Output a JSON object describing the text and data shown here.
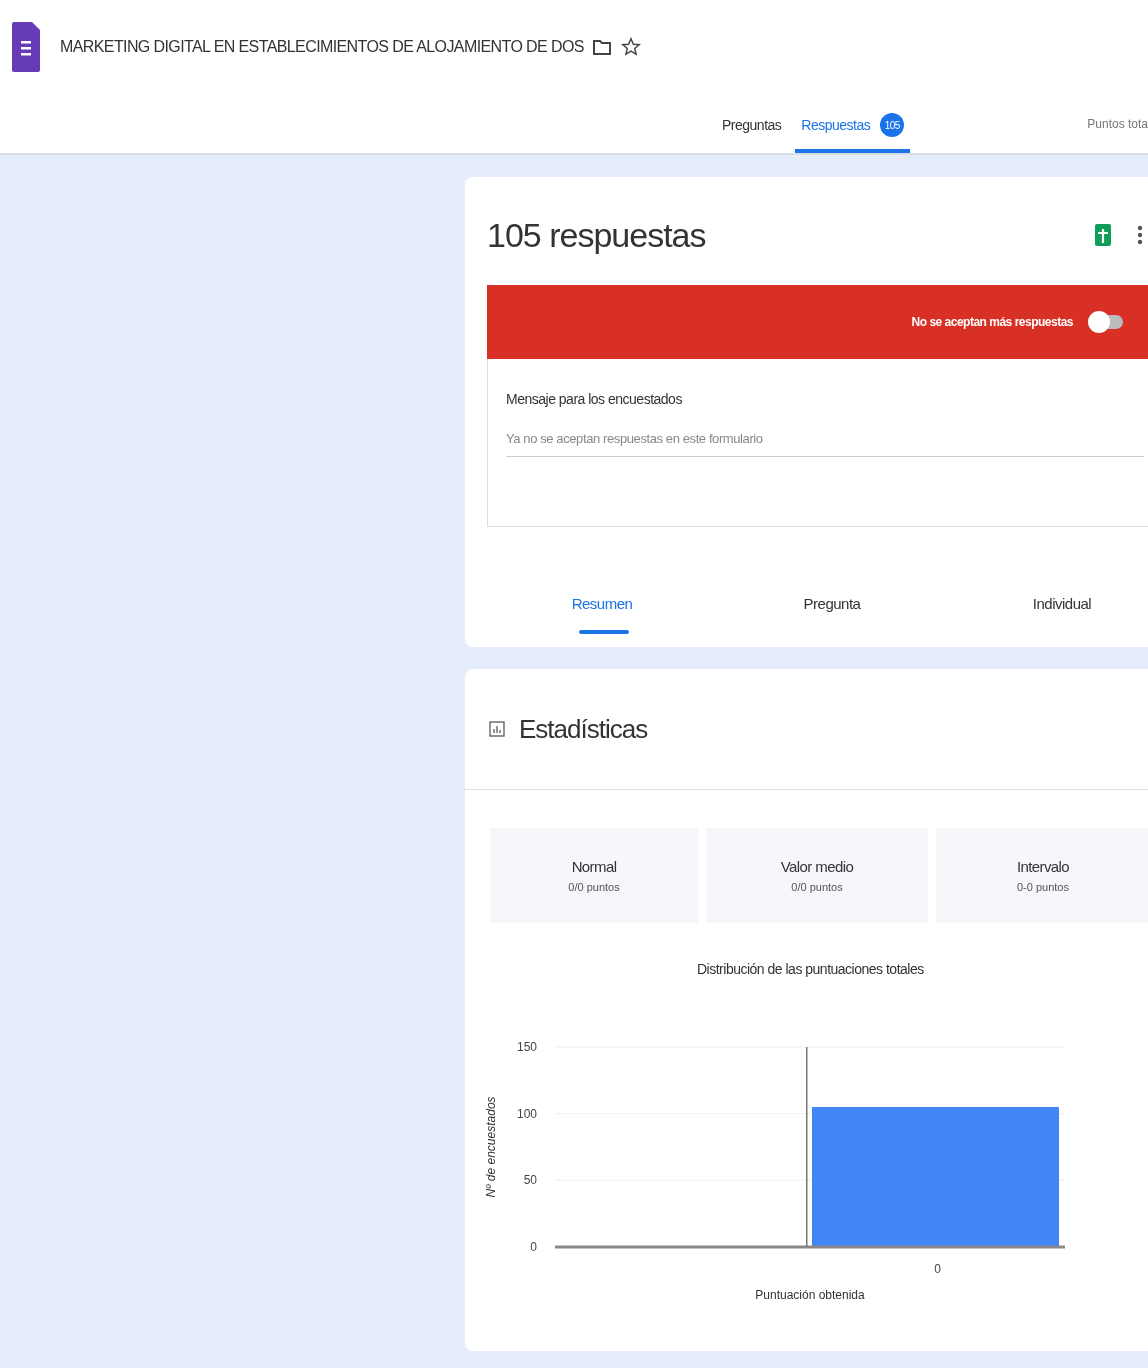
{
  "header": {
    "title": "MARKETING DIGITAL EN ESTABLECIMIENTOS DE ALOJAMIENTO DE DOS"
  },
  "tabs": [
    {
      "label": "Preguntas",
      "selected": false
    },
    {
      "label": "Respuestas",
      "selected": true,
      "badge": "105"
    }
  ],
  "total_points": "Puntos tota",
  "responses": {
    "title": "105 respuestas",
    "banner": {
      "label": "No se aceptan más respuestas",
      "on": false
    },
    "message": {
      "label": "Mensaje para los encuestados",
      "placeholder": "Ya no se aceptan respuestas en este formulario"
    },
    "view_tabs": [
      {
        "label": "Resumen",
        "selected": true
      },
      {
        "label": "Pregunta",
        "selected": false
      },
      {
        "label": "Individual",
        "selected": false
      }
    ]
  },
  "stats": {
    "title": "Estadísticas",
    "cards": [
      {
        "label": "Normal",
        "value": "0/0 puntos"
      },
      {
        "label": "Valor medio",
        "value": "0/0 puntos"
      },
      {
        "label": "Intervalo",
        "value": "0-0 puntos"
      }
    ],
    "chart_data": {
      "type": "bar",
      "title": "Distribución de las puntuaciones totales",
      "xlabel": "Puntuación obtenida",
      "ylabel": "Nº de encuestados",
      "categories": [
        "0"
      ],
      "series": [
        {
          "color": "#4285f4",
          "values": [
            105
          ]
        }
      ],
      "ylim": [
        0,
        150
      ],
      "yticks": [
        0,
        50,
        100,
        150
      ]
    }
  }
}
